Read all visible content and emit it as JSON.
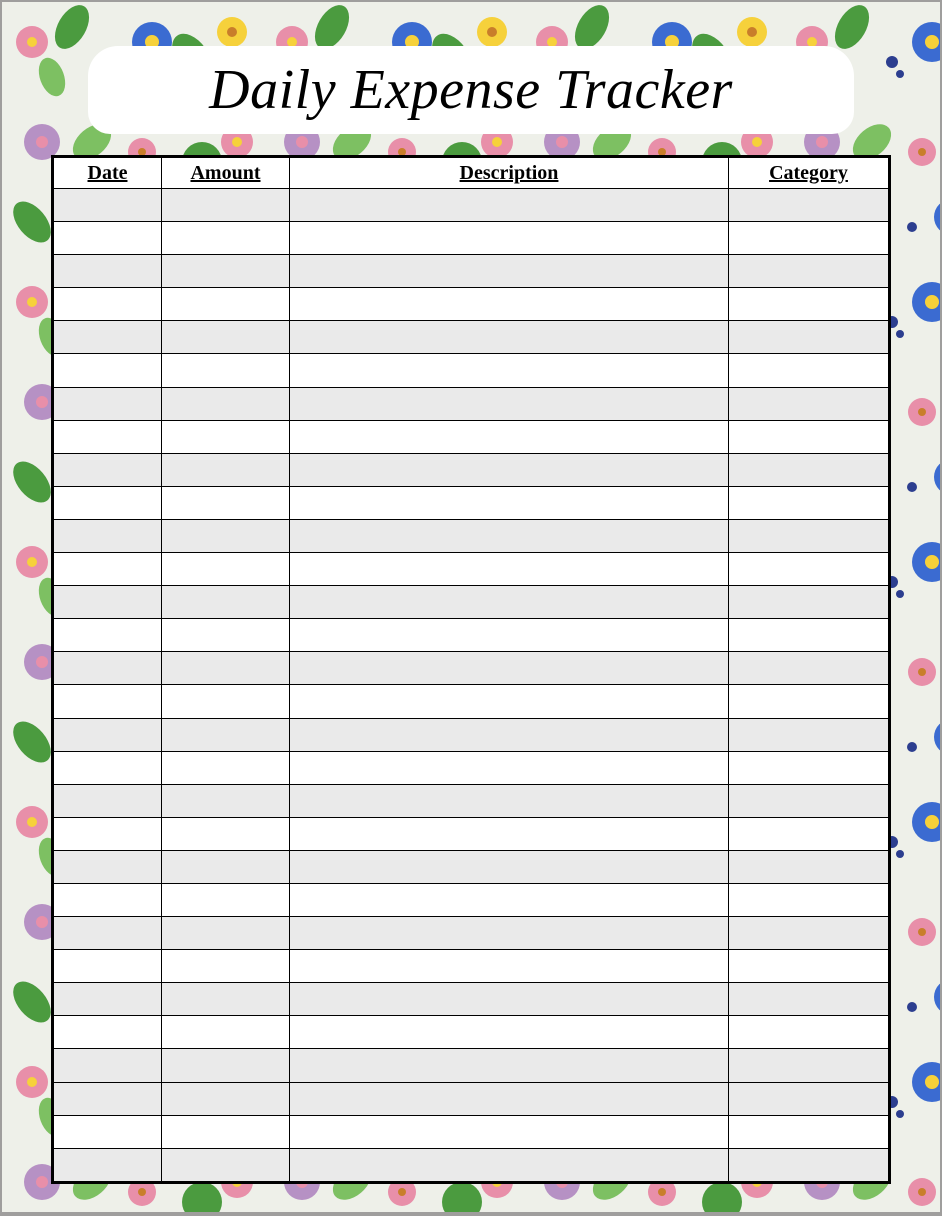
{
  "title": "Daily Expense Tracker",
  "columns": [
    "Date",
    "Amount",
    "Description",
    "Category"
  ],
  "rows": [
    {
      "date": "",
      "amount": "",
      "description": "",
      "category": ""
    },
    {
      "date": "",
      "amount": "",
      "description": "",
      "category": ""
    },
    {
      "date": "",
      "amount": "",
      "description": "",
      "category": ""
    },
    {
      "date": "",
      "amount": "",
      "description": "",
      "category": ""
    },
    {
      "date": "",
      "amount": "",
      "description": "",
      "category": ""
    },
    {
      "date": "",
      "amount": "",
      "description": "",
      "category": ""
    },
    {
      "date": "",
      "amount": "",
      "description": "",
      "category": ""
    },
    {
      "date": "",
      "amount": "",
      "description": "",
      "category": ""
    },
    {
      "date": "",
      "amount": "",
      "description": "",
      "category": ""
    },
    {
      "date": "",
      "amount": "",
      "description": "",
      "category": ""
    },
    {
      "date": "",
      "amount": "",
      "description": "",
      "category": ""
    },
    {
      "date": "",
      "amount": "",
      "description": "",
      "category": ""
    },
    {
      "date": "",
      "amount": "",
      "description": "",
      "category": ""
    },
    {
      "date": "",
      "amount": "",
      "description": "",
      "category": ""
    },
    {
      "date": "",
      "amount": "",
      "description": "",
      "category": ""
    },
    {
      "date": "",
      "amount": "",
      "description": "",
      "category": ""
    },
    {
      "date": "",
      "amount": "",
      "description": "",
      "category": ""
    },
    {
      "date": "",
      "amount": "",
      "description": "",
      "category": ""
    },
    {
      "date": "",
      "amount": "",
      "description": "",
      "category": ""
    },
    {
      "date": "",
      "amount": "",
      "description": "",
      "category": ""
    },
    {
      "date": "",
      "amount": "",
      "description": "",
      "category": ""
    },
    {
      "date": "",
      "amount": "",
      "description": "",
      "category": ""
    },
    {
      "date": "",
      "amount": "",
      "description": "",
      "category": ""
    },
    {
      "date": "",
      "amount": "",
      "description": "",
      "category": ""
    },
    {
      "date": "",
      "amount": "",
      "description": "",
      "category": ""
    },
    {
      "date": "",
      "amount": "",
      "description": "",
      "category": ""
    },
    {
      "date": "",
      "amount": "",
      "description": "",
      "category": ""
    },
    {
      "date": "",
      "amount": "",
      "description": "",
      "category": ""
    },
    {
      "date": "",
      "amount": "",
      "description": "",
      "category": ""
    },
    {
      "date": "",
      "amount": "",
      "description": "",
      "category": ""
    }
  ],
  "row_shading": [
    "tinted",
    "plain",
    "tinted",
    "plain",
    "tinted",
    "plain",
    "tinted",
    "plain",
    "tinted",
    "plain",
    "tinted",
    "plain",
    "tinted",
    "plain",
    "tinted",
    "plain",
    "tinted",
    "plain",
    "tinted",
    "plain",
    "tinted",
    "plain",
    "tinted",
    "plain",
    "tinted",
    "plain",
    "tinted",
    "tinted",
    "plain",
    "tinted"
  ]
}
